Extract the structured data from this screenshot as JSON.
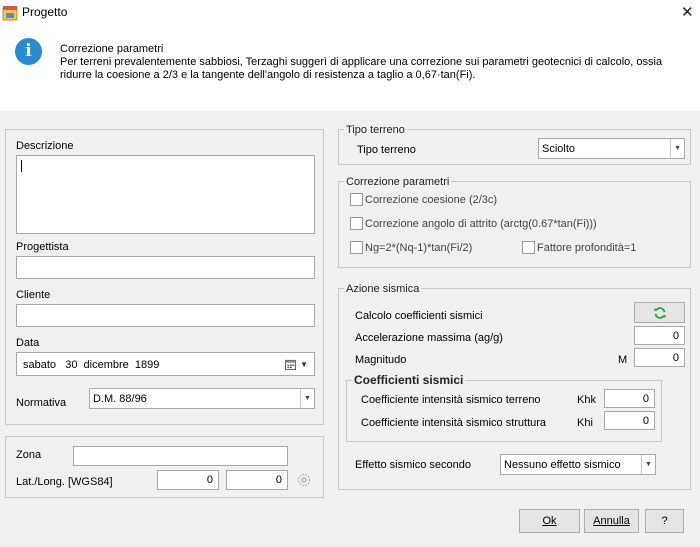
{
  "window": {
    "title": "Progetto",
    "close_glyph": "✕",
    "app_icon": "project-app-icon"
  },
  "info": {
    "icon": "info-icon",
    "icon_glyph": "i",
    "heading": "Correzione parametri",
    "text": "Per terreni prevalentemente sabbiosi, Terzaghi suggerì di  applicare una correzione sui parametri geotecnici di calcolo, ossia ridurre la coesione a 2/3 e la tangente dell'angolo di resistenza a taglio a 0,67·tan(Fi)."
  },
  "general": {
    "descrizione_label": "Descrizione",
    "descrizione_value": "",
    "progettista_label": "Progettista",
    "progettista_value": "",
    "cliente_label": "Cliente",
    "cliente_value": "",
    "data_label": "Data",
    "data_value": "sabato   30  dicembre  1899",
    "normativa_label": "Normativa",
    "normativa_value": "D.M. 88/96"
  },
  "location": {
    "zona_label": "Zona",
    "zona_value": "",
    "latlong_label": "Lat./Long. [WGS84]",
    "lat_value": "0",
    "long_value": "0"
  },
  "tipo_terreno": {
    "group_title": "Tipo terreno",
    "label": "Tipo terreno",
    "value": "Sciolto"
  },
  "correzione": {
    "group_title": "Correzione parametri",
    "coesione_label": "Correzione coesione (2/3c)",
    "attrito_label": "Correzione angolo di attrito (arctg(0.67*tan(Fi)))",
    "ng_label": "Ng=2*(Nq-1)*tan(Fi/2)",
    "profondita_label": "Fattore profondità=1"
  },
  "sismica": {
    "group_title": "Azione sismica",
    "calcolo_label": "Calcolo coefficienti sismici",
    "accel_label": "Accelerazione massima (ag/g)",
    "accel_value": "0",
    "magnitudo_label": "Magnitudo",
    "magnitudo_unit": "M",
    "magnitudo_value": "0",
    "coeff_title": "Coefficienti sismici",
    "terreno_label": "Coefficiente intensità sismico terreno",
    "khk_label": "Khk",
    "khk_value": "0",
    "struttura_label": "Coefficiente intensità sismico struttura",
    "khi_label": "Khi",
    "khi_value": "0",
    "effetto_label": "Effetto sismico secondo",
    "effetto_value": "Nessuno effetto sismico"
  },
  "buttons": {
    "ok": "Ok",
    "annulla": "Annulla",
    "help": "?"
  }
}
